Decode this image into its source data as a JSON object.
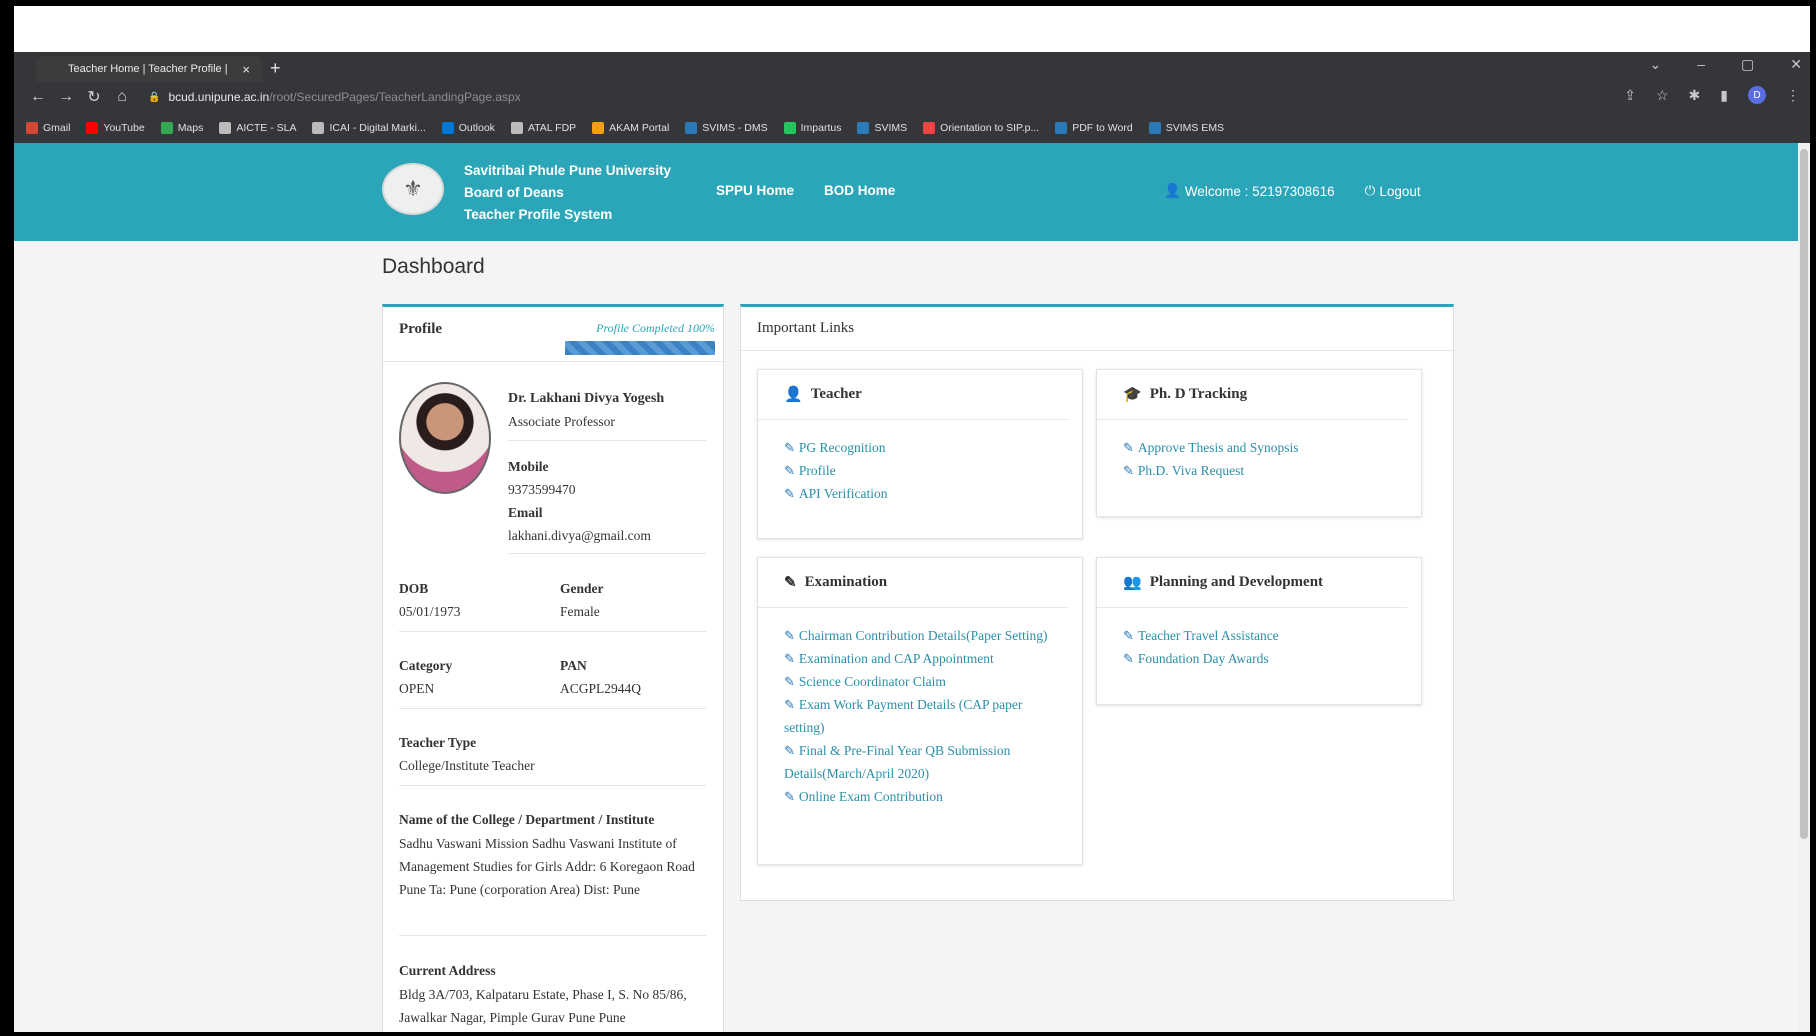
{
  "browser": {
    "tab_title": "Teacher Home | Teacher Profile |",
    "tab_close": "×",
    "new_tab": "+",
    "url_host": "bcud.unipune.ac.in",
    "url_path": "/root/SecuredPages/TeacherLandingPage.aspx",
    "bookmarks": [
      {
        "label": "Gmail",
        "color": "#d44638"
      },
      {
        "label": "YouTube",
        "color": "#ff0000"
      },
      {
        "label": "Maps",
        "color": "#34a853"
      },
      {
        "label": "AICTE - SLA",
        "color": "#bbbbbb"
      },
      {
        "label": "ICAI - Digital Marki...",
        "color": "#bbbbbb"
      },
      {
        "label": "Outlook",
        "color": "#0078d4"
      },
      {
        "label": "ATAL FDP",
        "color": "#bbbbbb"
      },
      {
        "label": "AKAM Portal",
        "color": "#f59e0b"
      },
      {
        "label": "SVIMS - DMS",
        "color": "#2b7bb9"
      },
      {
        "label": "Impartus",
        "color": "#22c55e"
      },
      {
        "label": "SVIMS",
        "color": "#2b7bb9"
      },
      {
        "label": "Orientation to SIP.p...",
        "color": "#ef4444"
      },
      {
        "label": "PDF to Word",
        "color": "#2b7bb9"
      },
      {
        "label": "SVIMS EMS",
        "color": "#2b7bb9"
      }
    ]
  },
  "header": {
    "brand_line1": "Savitribai Phule Pune University",
    "brand_line2": "Board of Deans",
    "brand_line3": "Teacher Profile System",
    "nav": [
      "SPPU Home",
      "BOD Home"
    ],
    "welcome": "Welcome : 52197308616",
    "logout": "Logout",
    "accent": "#2ba6b8"
  },
  "page_title": "Dashboard",
  "profile": {
    "title": "Profile",
    "completion_label": "Profile Completed 100%",
    "completion": 1.0,
    "name": "Dr. Lakhani Divya Yogesh",
    "designation": "Associate Professor",
    "mobile_label": "Mobile",
    "mobile": "9373599470",
    "email_label": "Email",
    "email": "lakhani.divya@gmail.com",
    "dob_label": "DOB",
    "dob": "05/01/1973",
    "gender_label": "Gender",
    "gender": "Female",
    "category_label": "Category",
    "category": "OPEN",
    "pan_label": "PAN",
    "pan": "ACGPL2944Q",
    "teacher_type_label": "Teacher Type",
    "teacher_type": "College/Institute Teacher",
    "institute_label": "Name of the College / Department / Institute",
    "institute": "Sadhu Vaswani Mission Sadhu Vaswani Institute of Management Studies for Girls Addr: 6 Koregaon Road Pune Ta: Pune (corporation Area) Dist: Pune",
    "address_label": "Current Address",
    "address": "Bldg 3A/703, Kalpataru Estate, Phase I, S. No 85/86, Jawalkar Nagar, Pimple Gurav Pune Pune"
  },
  "important_links": {
    "title": "Important Links",
    "cards": {
      "teacher": {
        "title": "Teacher",
        "icon": "user-icon",
        "links": [
          "PG Recognition",
          "Profile",
          "API Verification"
        ]
      },
      "phd": {
        "title": "Ph. D Tracking",
        "icon": "graduation-cap-icon",
        "links": [
          "Approve Thesis and Synopsis",
          "Ph.D. Viva Request"
        ]
      },
      "exam": {
        "title": "Examination",
        "icon": "edit-icon",
        "links": [
          "Chairman Contribution Details(Paper Setting)",
          "Examination and CAP Appointment",
          "Science Coordinator Claim",
          "Exam Work Payment Details (CAP paper setting)",
          "Final & Pre-Final Year QB Submission Details(March/April 2020)",
          "Online Exam Contribution"
        ]
      },
      "planning": {
        "title": "Planning and Development",
        "icon": "users-icon",
        "links": [
          "Teacher Travel Assistance",
          "Foundation Day Awards"
        ]
      }
    }
  }
}
